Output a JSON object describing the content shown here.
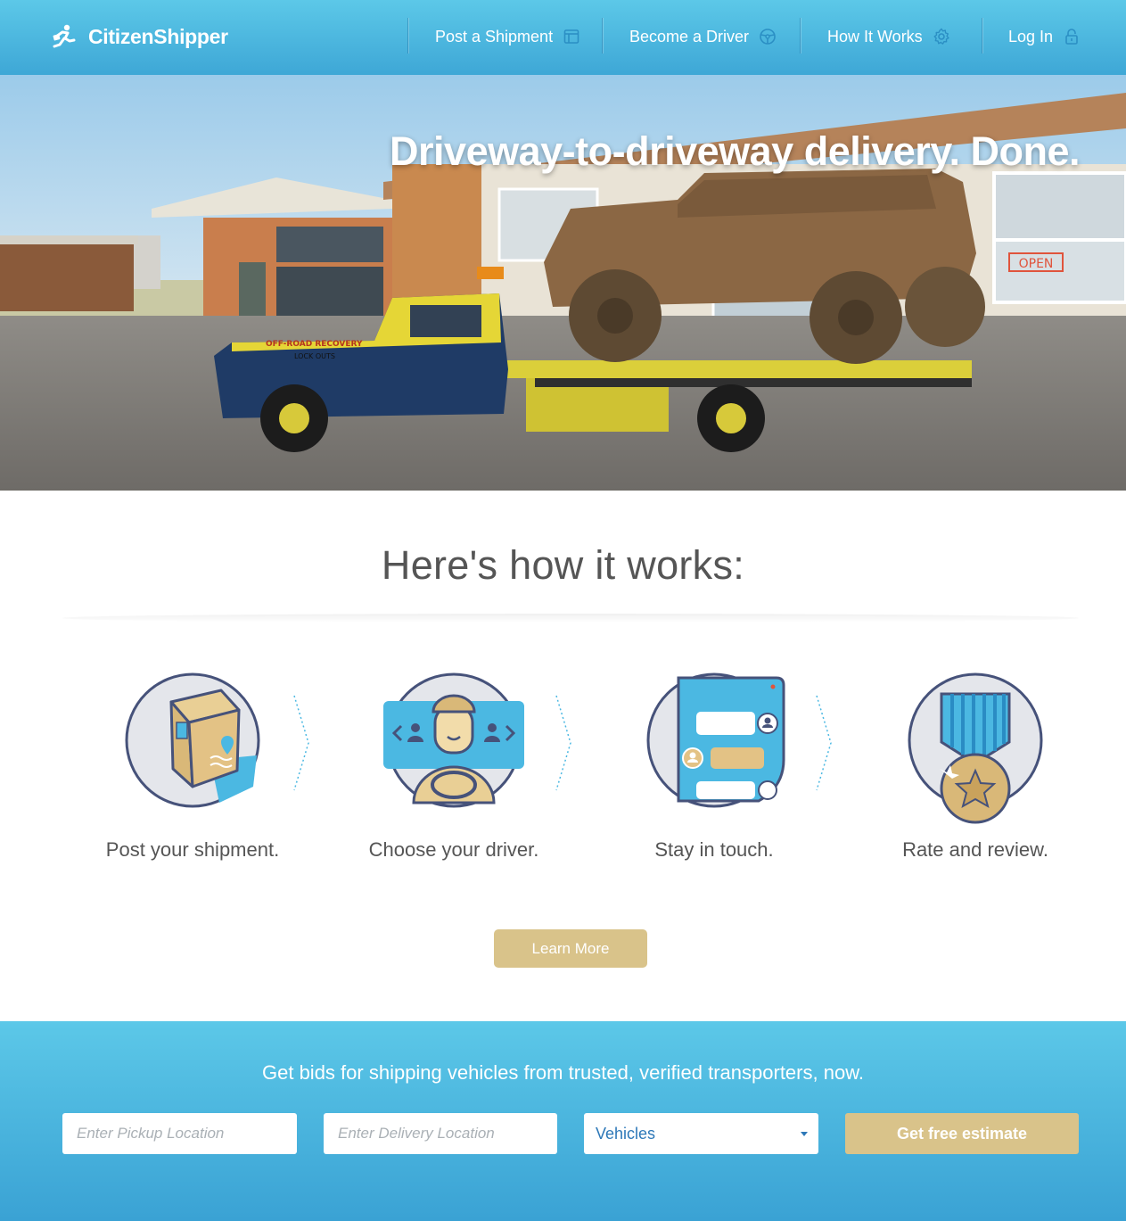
{
  "brand": {
    "name": "CitizenShipper"
  },
  "nav": {
    "items": [
      {
        "label": "Post a Shipment",
        "icon": "clipboard-icon"
      },
      {
        "label": "Become a Driver",
        "icon": "steering-wheel-icon"
      },
      {
        "label": "How It Works",
        "icon": "gear-icon"
      },
      {
        "label": "Log In",
        "icon": "lock-icon"
      }
    ]
  },
  "hero": {
    "headline": "Driveway-to-driveway delivery. Done.",
    "sign_text": "OPEN",
    "truck_text_1": "OFF-ROAD RECOVERY",
    "truck_text_2": "LOCK OUTS"
  },
  "how": {
    "title": "Here's how it works:",
    "steps": [
      {
        "label": "Post your shipment.",
        "icon": "package-icon"
      },
      {
        "label": "Choose your driver.",
        "icon": "driver-icon"
      },
      {
        "label": "Stay in touch.",
        "icon": "chat-icon"
      },
      {
        "label": "Rate and review.",
        "icon": "medal-icon"
      }
    ],
    "learn_more": "Learn More"
  },
  "quote": {
    "title": "Get bids for shipping vehicles from trusted, verified transporters, now.",
    "pickup_placeholder": "Enter Pickup Location",
    "delivery_placeholder": "Enter Delivery Location",
    "vehicle_type": "Vehicles",
    "submit": "Get free estimate"
  },
  "colors": {
    "brand_blue": "#4bb8e2",
    "gold": "#d9c38a",
    "text": "#555555"
  }
}
